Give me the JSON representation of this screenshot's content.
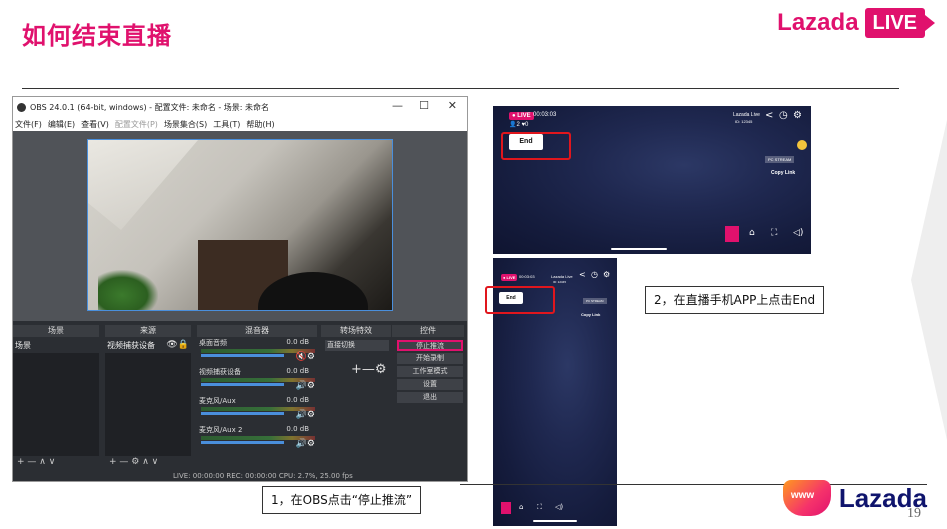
{
  "slide": {
    "title": "如何结束直播",
    "page_number": "19",
    "accent": "#e0116d"
  },
  "brand": {
    "top_word": "Lazada",
    "top_live": "LIVE",
    "bottom_word": "Lazada"
  },
  "obs": {
    "title": "OBS 24.0.1 (64-bit, windows) - 配置文件: 未命名 - 场景: 未命名",
    "win_controls": [
      "—",
      "☐",
      "✕"
    ],
    "menu": [
      {
        "label": "文件(F)",
        "disabled": false
      },
      {
        "label": "编辑(E)",
        "disabled": false
      },
      {
        "label": "查看(V)",
        "disabled": false
      },
      {
        "label": "配置文件(P)",
        "disabled": true
      },
      {
        "label": "场景集合(S)",
        "disabled": false
      },
      {
        "label": "工具(T)",
        "disabled": false
      },
      {
        "label": "帮助(H)",
        "disabled": false
      }
    ],
    "docks": {
      "scenes": {
        "header": "场景",
        "items": [
          "场景"
        ]
      },
      "sources": {
        "header": "来源",
        "items": [
          "视频捕获设备"
        ]
      },
      "mixer": {
        "header": "混音器",
        "channels": [
          {
            "name": "桌面音频",
            "db": "0.0 dB",
            "muted": true
          },
          {
            "name": "视频捕获设备",
            "db": "0.0 dB",
            "muted": false
          },
          {
            "name": "麦克风/Aux",
            "db": "0.0 dB",
            "muted": false
          },
          {
            "name": "麦克风/Aux 2",
            "db": "0.0 dB",
            "muted": false
          }
        ]
      },
      "transitions": {
        "header": "转场特效",
        "selected": "直接切换"
      },
      "controls": {
        "header": "控件",
        "buttons": [
          "停止推流",
          "开始录制",
          "工作室模式",
          "设置",
          "退出"
        ]
      }
    },
    "footer_icons": "+ —  ∧ ∨",
    "footer_icons_sources": "+ — ⚙  ∧ ∨",
    "status": "LIVE: 00:00:00   REC: 00:00:00   CPU: 2.7%, 25.00 fps"
  },
  "phone_horizontal": {
    "live_badge": "● LIVE",
    "timer": "00:03:03",
    "stats": "👤2   ♥0",
    "end_button": "End",
    "lz_label": "Lazada Live",
    "lz_id": "ID: 12345",
    "pc_stream": "PC STREAM",
    "copy_link": "Copy Link"
  },
  "phone_vertical": {
    "live_badge": "● LIVE",
    "timer": "00:03:03",
    "end_button": "End",
    "lz_label": "Lazada Live",
    "lz_id": "ID: 12345",
    "pc_stream": "PC STREAM",
    "copy_link": "Copy Link"
  },
  "callouts": {
    "obs": "1，在OBS点击“停止推流”",
    "app": "2，在直播手机APP上点击End"
  }
}
